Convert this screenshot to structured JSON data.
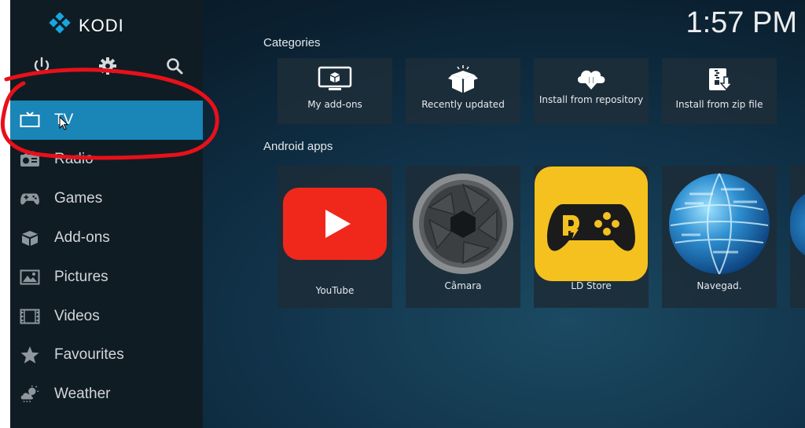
{
  "app": {
    "logo_text": "KODI"
  },
  "clock": "1:57 PM",
  "top_icons": [
    {
      "icon": "power-icon"
    },
    {
      "icon": "gear-icon"
    },
    {
      "icon": "search-icon"
    }
  ],
  "sidebar": {
    "items": [
      {
        "label": "TV",
        "icon": "tv-icon",
        "active": true
      },
      {
        "label": "Radio",
        "icon": "radio-icon"
      },
      {
        "label": "Games",
        "icon": "gamepad-icon"
      },
      {
        "label": "Add-ons",
        "icon": "addons-box-icon"
      },
      {
        "label": "Pictures",
        "icon": "picture-icon"
      },
      {
        "label": "Videos",
        "icon": "film-icon"
      },
      {
        "label": "Favourites",
        "icon": "star-icon"
      },
      {
        "label": "Weather",
        "icon": "weather-icon"
      }
    ]
  },
  "categories": {
    "title": "Categories",
    "tiles": [
      {
        "label": "My add-ons",
        "icon": "monitor-box-icon"
      },
      {
        "label": "Recently updated",
        "icon": "open-box-icon"
      },
      {
        "label": "Install from repository",
        "icon": "cloud-download-icon"
      },
      {
        "label": "Install from zip file",
        "icon": "zip-file-icon"
      }
    ]
  },
  "android_apps": {
    "title": "Android apps",
    "tiles": [
      {
        "label": "YouTube",
        "icon": "youtube-icon"
      },
      {
        "label": "Câmara",
        "icon": "camera-lens-icon"
      },
      {
        "label": "LD Store",
        "icon": "ld-store-gamepad-icon"
      },
      {
        "label": "Navegad.",
        "icon": "globe-icon"
      }
    ]
  },
  "colors": {
    "accent": "#1a85b7",
    "sidebar_bg": "#101c24",
    "annotation": "#e8101a",
    "youtube_red": "#f0281c",
    "ldstore_yellow": "#f5c11e"
  }
}
